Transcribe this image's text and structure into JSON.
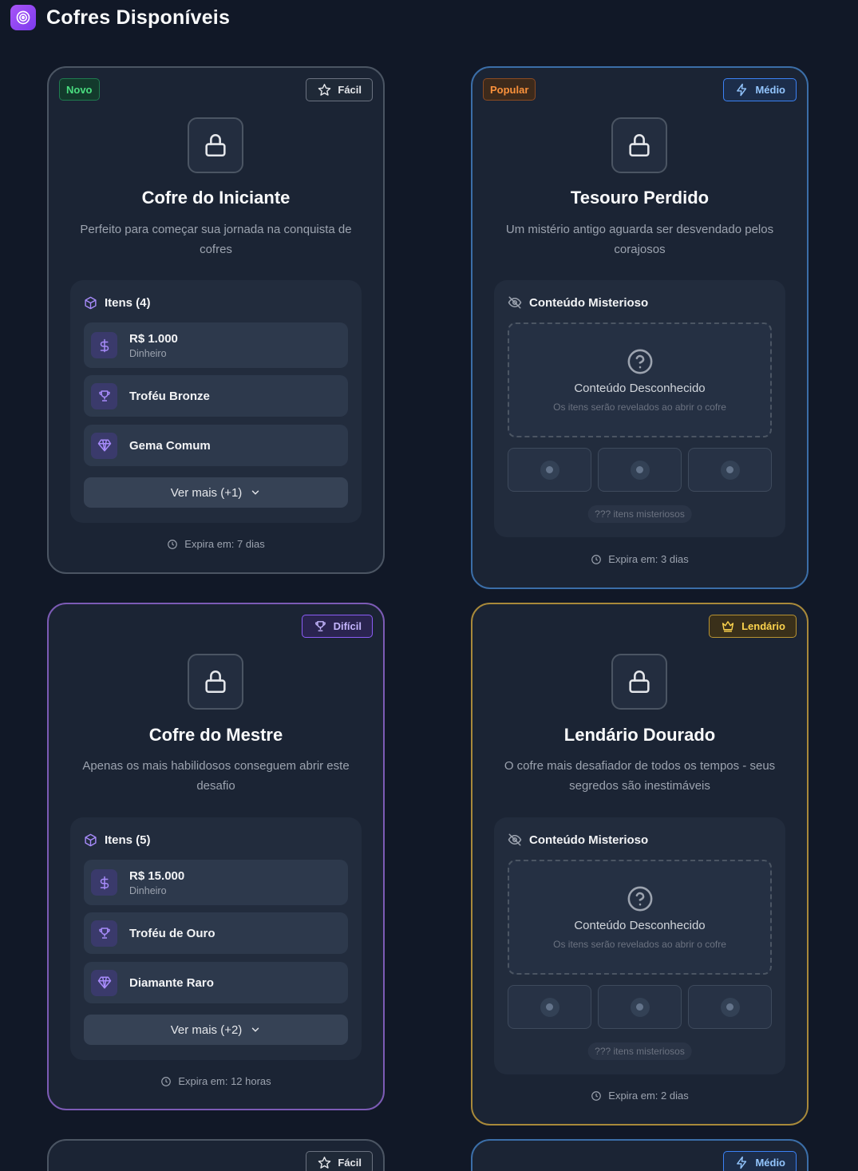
{
  "page": {
    "title": "Cofres Disponíveis",
    "icon": "target-icon"
  },
  "cards": [
    {
      "tag": "Novo",
      "difficulty": "Fácil",
      "difficulty_icon": "star-icon",
      "title": "Cofre do Iniciante",
      "description": "Perfeito para começar sua jornada na conquista de cofres",
      "items_header": "Itens (4)",
      "items": [
        {
          "name": "R$ 1.000",
          "sub": "Dinheiro",
          "icon": "dollar-icon"
        },
        {
          "name": "Troféu Bronze",
          "icon": "trophy-icon"
        },
        {
          "name": "Gema Comum",
          "icon": "gem-icon"
        }
      ],
      "more": "Ver mais (+1)",
      "expires": "Expira em: 7 dias"
    },
    {
      "tag": "Popular",
      "difficulty": "Médio",
      "difficulty_icon": "lightning-icon",
      "title": "Tesouro Perdido",
      "description": "Um mistério antigo aguarda ser desvendado pelos corajosos",
      "mystery_header": "Conteúdo Misterioso",
      "mystery_title": "Conteúdo Desconhecido",
      "mystery_sub": "Os itens serão revelados ao abrir o cofre",
      "mystery_count": "??? itens misteriosos",
      "expires": "Expira em: 3 dias"
    },
    {
      "difficulty": "Difícil",
      "difficulty_icon": "trophy-icon",
      "title": "Cofre do Mestre",
      "description": "Apenas os mais habilidosos conseguem abrir este desafio",
      "items_header": "Itens (5)",
      "items": [
        {
          "name": "R$ 15.000",
          "sub": "Dinheiro",
          "icon": "dollar-icon"
        },
        {
          "name": "Troféu de Ouro",
          "icon": "trophy-icon"
        },
        {
          "name": "Diamante Raro",
          "icon": "gem-icon"
        }
      ],
      "more": "Ver mais (+2)",
      "expires": "Expira em: 12 horas"
    },
    {
      "difficulty": "Lendário",
      "difficulty_icon": "crown-icon",
      "title": "Lendário Dourado",
      "description": "O cofre mais desafiador de todos os tempos - seus segredos são inestimáveis",
      "mystery_header": "Conteúdo Misterioso",
      "mystery_title": "Conteúdo Desconhecido",
      "mystery_sub": "Os itens serão revelados ao abrir o cofre",
      "mystery_count": "??? itens misteriosos",
      "expires": "Expira em: 2 dias"
    },
    {
      "difficulty": "Fácil",
      "difficulty_icon": "star-icon"
    },
    {
      "difficulty": "Médio",
      "difficulty_icon": "lightning-icon"
    }
  ],
  "colors": {
    "background": "#111827",
    "card": "#1b2434",
    "accent_purple": "#a855f7",
    "blue_border": "#3b6ea8",
    "purple_border": "#7c5bb5",
    "gold_border": "#a8893a"
  }
}
